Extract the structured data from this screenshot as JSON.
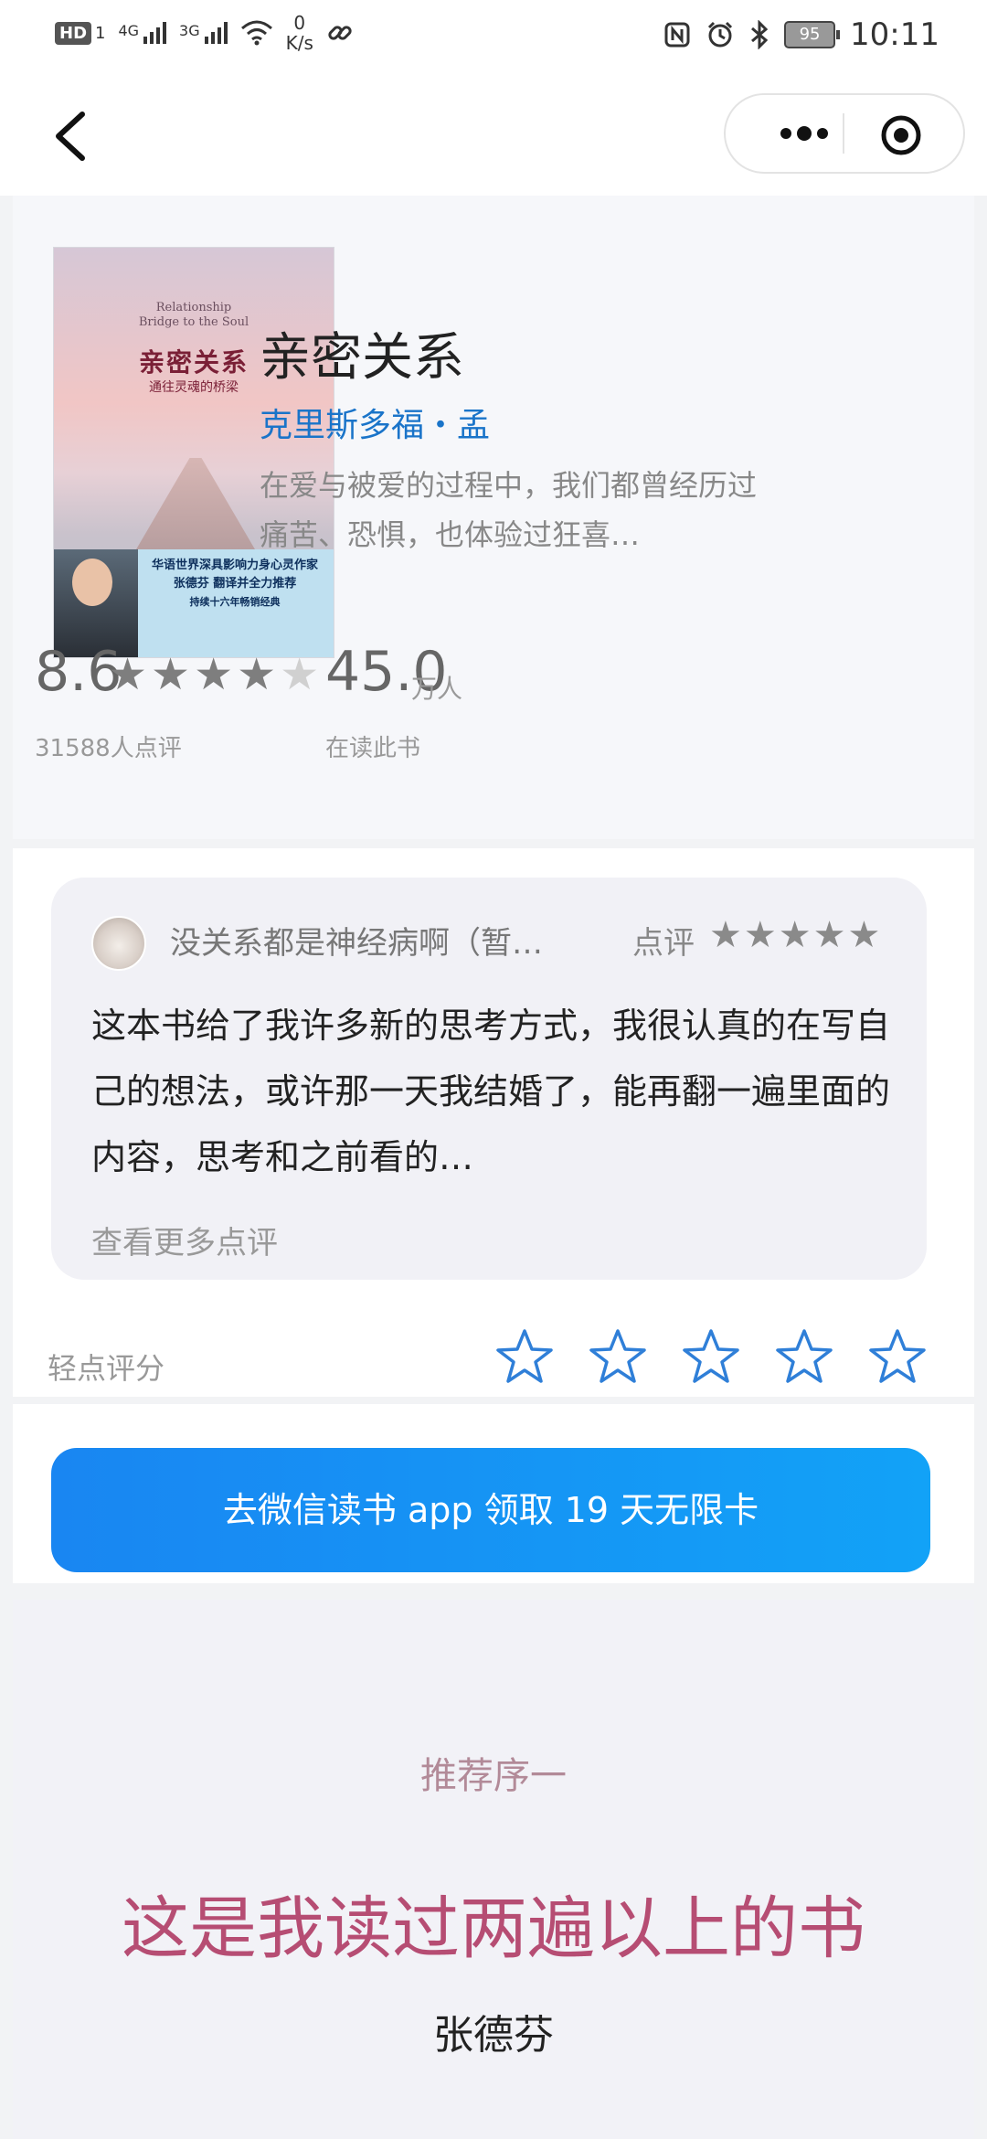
{
  "status_bar": {
    "hd": "HD",
    "sim1": "1",
    "net1": "4G",
    "net2": "3G",
    "speed_value": "0",
    "speed_unit": "K/s",
    "battery": "95",
    "time": "10:11"
  },
  "book": {
    "title": "亲密关系",
    "author": "克里斯多福・孟",
    "description": "在爱与被爱的过程中，我们都曾经历过痛苦、恐惧，也体验过狂喜…",
    "cover": {
      "en_title_1": "Relationship",
      "en_title_2": "Bridge to the Soul",
      "cn_title": "亲密关系",
      "cn_subtitle": "通往灵魂的桥梁",
      "blurb_1": "华语世界深具影响力身心灵作家",
      "blurb_2": "张德芬  翻译并全力推荐",
      "blurb_3": "持续十六年畅销经典"
    },
    "rating": "8.6",
    "rating_stars": 4.5,
    "rating_count": "31588人点评",
    "reading_count": "45.0",
    "reading_unit": "万人",
    "reading_label": "在读此书"
  },
  "review": {
    "user": "没关系都是神经病啊（暂…",
    "label": "点评",
    "stars": "★★★★★",
    "text": "这本书给了我许多新的思考方式，我很认真的在写自己的想法，或许那一天我结婚了，能再翻一遍里面的内容，思考和之前看的…",
    "more": "查看更多点评"
  },
  "quick_rating": {
    "label": "轻点评分",
    "star_count": 5
  },
  "cta": {
    "label": "去微信读书 app 领取 19 天无限卡"
  },
  "preface": {
    "label": "推荐序一",
    "title": "这是我读过两遍以上的书",
    "author": "张德芬"
  }
}
